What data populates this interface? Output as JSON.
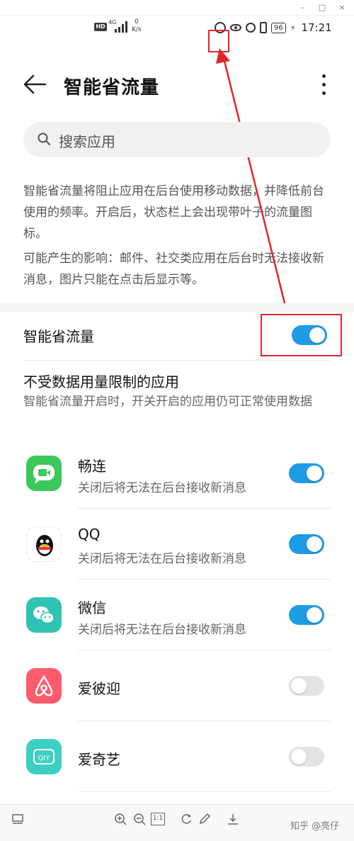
{
  "window": {
    "min": "–",
    "max": "□",
    "close": "×"
  },
  "status_bar": {
    "network": "HD",
    "network_type": "4G",
    "speed_value": "0",
    "speed_unit": "K/s",
    "battery": "96",
    "time": "17:21"
  },
  "header": {
    "title": "智能省流量"
  },
  "search": {
    "placeholder": "搜索应用"
  },
  "description": {
    "paragraph_1": "智能省流量将阻止应用在后台使用移动数据，并降低前台使用的频率。开启后，状态栏上会出现带叶子的流量图标。",
    "paragraph_2": "可能产生的影响：邮件、社交类应用在后台时无法接收新消息，图片只能在点击后显示等。"
  },
  "main_toggle": {
    "label": "智能省流量",
    "enabled": true
  },
  "unrestricted_section": {
    "title": "不受数据用量限制的应用",
    "subtitle": "智能省流量开启时，开关开启的应用仍可正常使用数据"
  },
  "apps": [
    {
      "name": "畅连",
      "desc": "关闭后将无法在后台接收新消息",
      "enabled": true,
      "icon": "changlian-icon",
      "color": "#3cc85a"
    },
    {
      "name": "QQ",
      "desc": "关闭后将无法在后台接收新消息",
      "enabled": true,
      "icon": "qq-icon",
      "color": "#ffffff"
    },
    {
      "name": "微信",
      "desc": "关闭后将无法在后台接收新消息",
      "enabled": true,
      "icon": "wechat-icon",
      "color": "#2fc4b2"
    },
    {
      "name": "爱彼迎",
      "desc": "",
      "enabled": false,
      "icon": "airbnb-icon",
      "color": "#ff5a6e"
    },
    {
      "name": "爱奇艺",
      "desc": "",
      "enabled": false,
      "icon": "iqiyi-icon",
      "color": "#3ccfc4"
    }
  ],
  "colors": {
    "toggle_on": "#1e9be5",
    "toggle_off": "#e3e3e3",
    "highlight": "#e3262b"
  },
  "toolbar": {
    "zoom_fit": "1:1"
  },
  "watermark": "知乎 @亮仔"
}
